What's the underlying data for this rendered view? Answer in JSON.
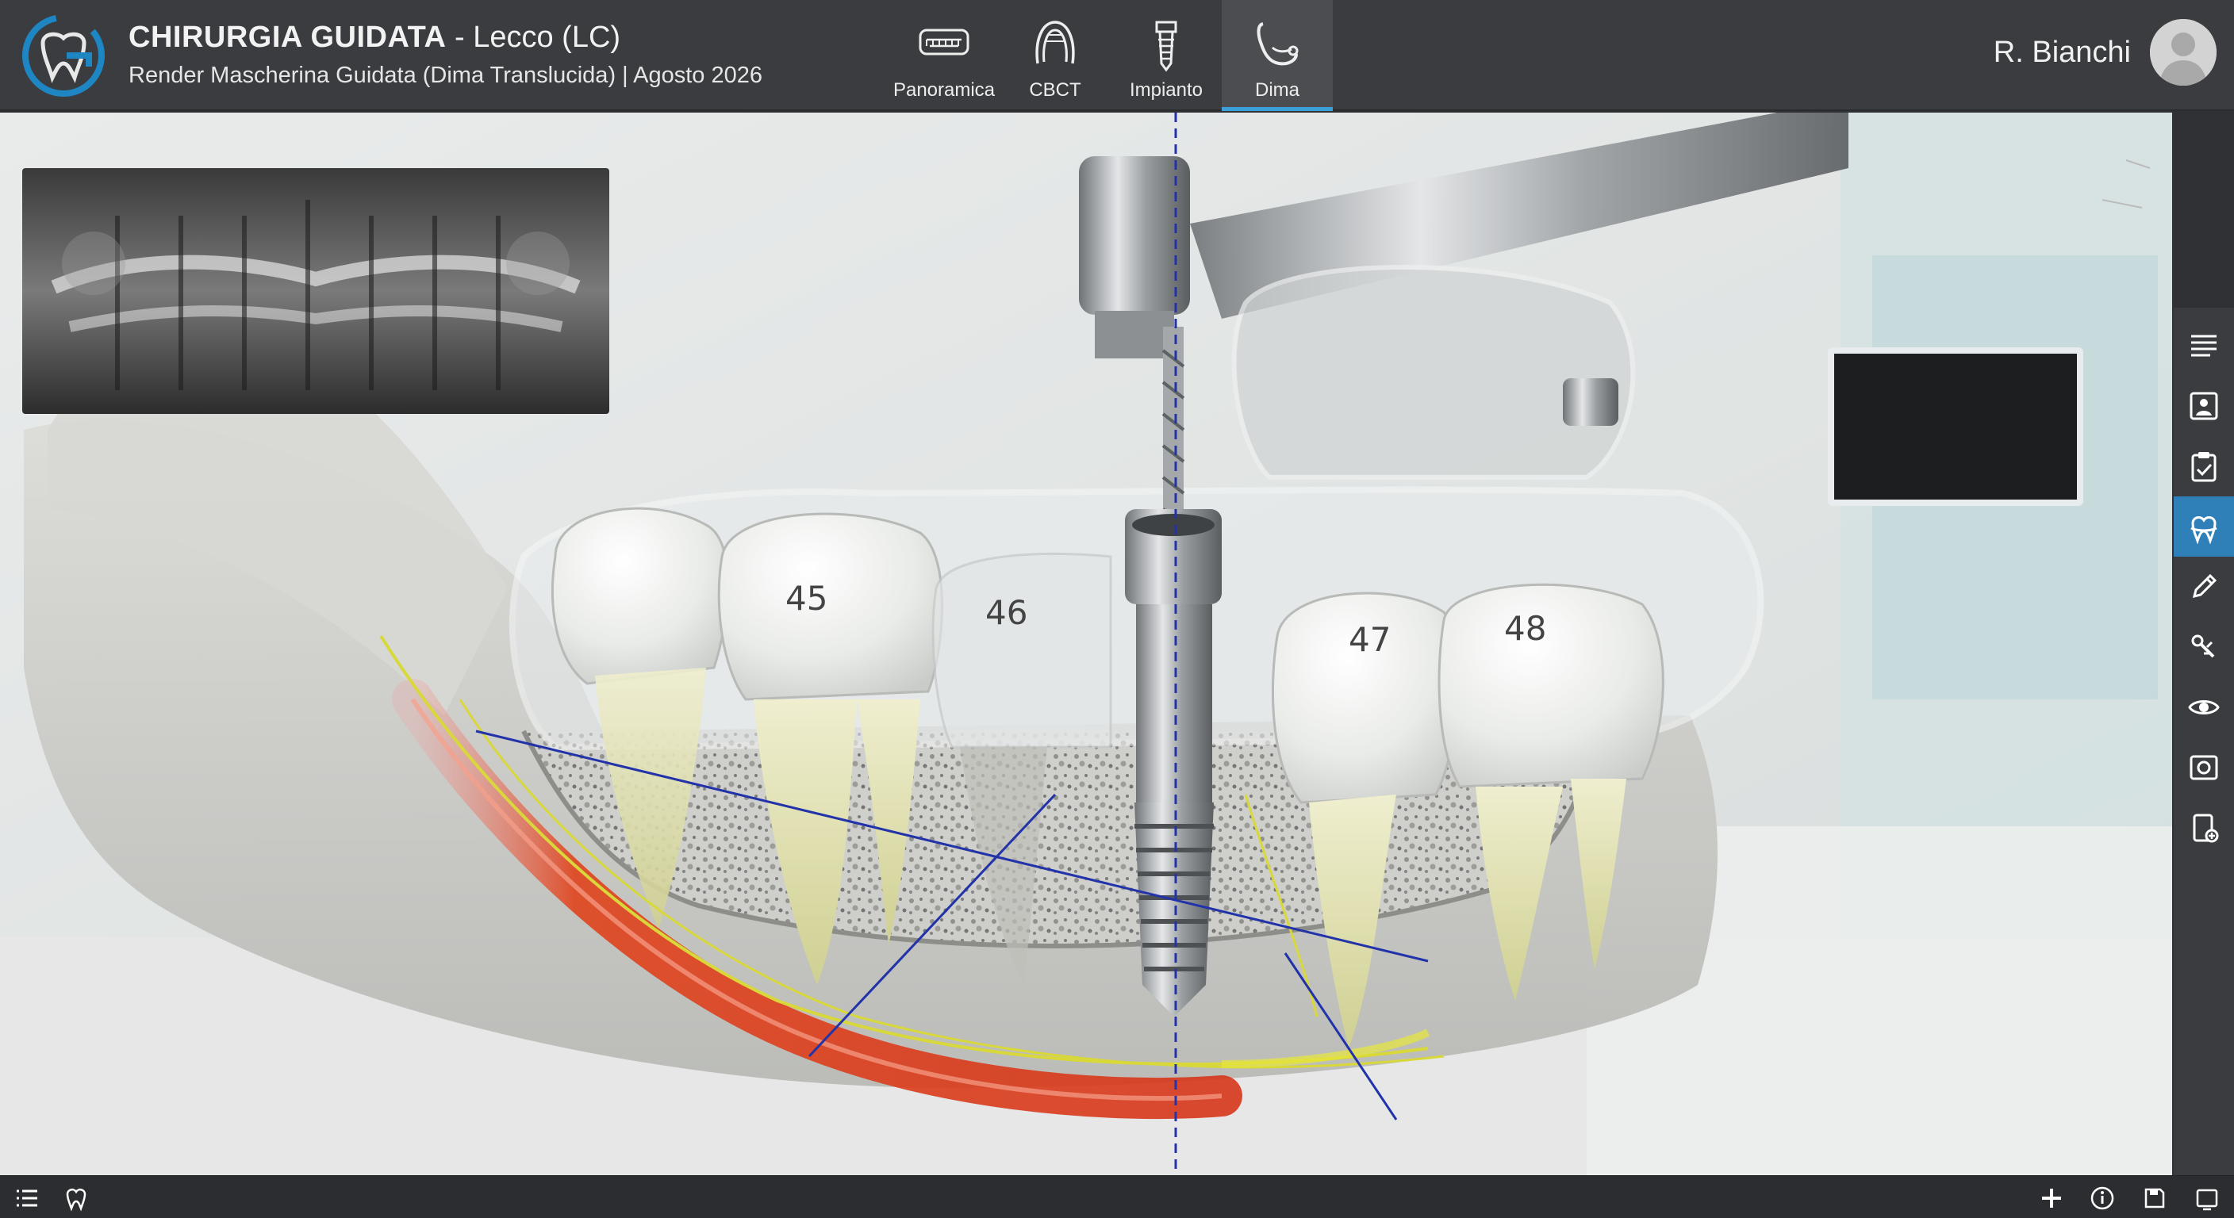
{
  "header": {
    "title_bold": "CHIRURGIA GUIDATA",
    "title_rest": " - Lecco (LC)",
    "subtitle": "Render Mascherina Guidata (Dima Translucida) | Agosto 2026"
  },
  "tabs": [
    {
      "label": "Panoramica",
      "icon": "panoramic-icon"
    },
    {
      "label": "CBCT",
      "icon": "cbct-icon"
    },
    {
      "label": "Impianto",
      "icon": "implant-icon"
    },
    {
      "label": "Dima",
      "icon": "guide-icon",
      "active": true
    }
  ],
  "user": {
    "name": "R. Bianchi"
  },
  "viewport": {
    "tooth_labels": [
      "45",
      "46",
      "47",
      "48"
    ]
  },
  "right_toolbar": [
    {
      "icon": "menu-lines-icon"
    },
    {
      "icon": "patient-card-icon"
    },
    {
      "icon": "clipboard-check-icon"
    },
    {
      "icon": "tooth-guide-icon",
      "active": true
    },
    {
      "icon": "pen-tool-icon"
    },
    {
      "icon": "drill-tools-icon"
    },
    {
      "icon": "eye-icon"
    },
    {
      "icon": "screenshot-icon"
    },
    {
      "icon": "export-device-icon"
    }
  ],
  "bottom_bar": {
    "left": [
      "list-icon",
      "tooth-outline-icon"
    ],
    "right": [
      "add-icon",
      "info-icon",
      "save-icon",
      "window-icon"
    ]
  },
  "colors": {
    "header_bg": "#3a3c3f",
    "accent": "#3aa0d8",
    "active_tool": "#2f7fb8",
    "nerve": "#e0431c",
    "guide_line": "#d8d83a",
    "axis_line": "#2233aa"
  }
}
